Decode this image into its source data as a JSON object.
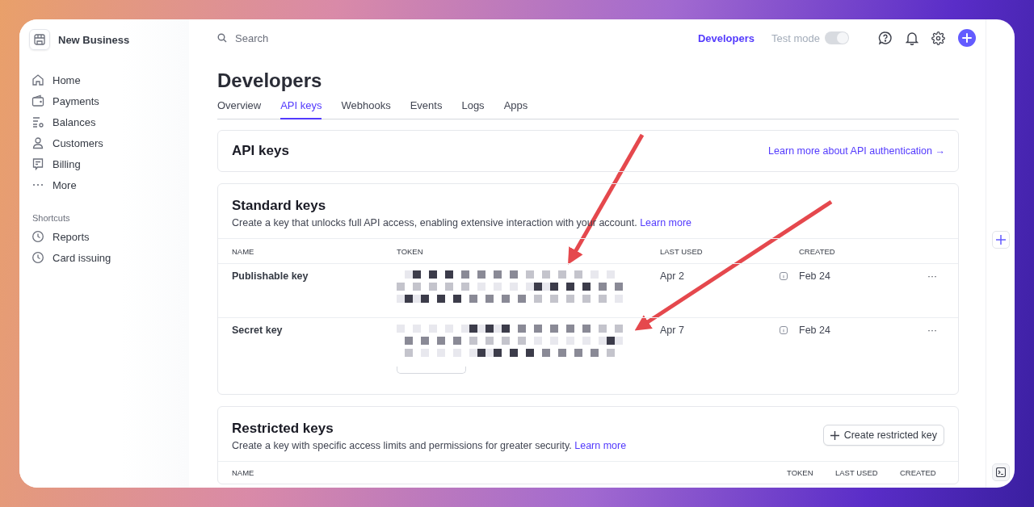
{
  "account": {
    "name": "New Business"
  },
  "search": {
    "placeholder": "Search"
  },
  "topbar": {
    "developers_link": "Developers",
    "test_mode": {
      "label": "Test mode",
      "on": true,
      "disabled": true
    }
  },
  "sidebar": {
    "items": [
      {
        "label": "Home"
      },
      {
        "label": "Payments"
      },
      {
        "label": "Balances"
      },
      {
        "label": "Customers"
      },
      {
        "label": "Billing"
      },
      {
        "label": "More"
      }
    ],
    "shortcuts_title": "Shortcuts",
    "shortcuts": [
      {
        "label": "Reports"
      },
      {
        "label": "Card issuing"
      }
    ]
  },
  "page": {
    "title": "Developers",
    "tabs": [
      {
        "label": "Overview",
        "selected": false
      },
      {
        "label": "API keys",
        "selected": true
      },
      {
        "label": "Webhooks",
        "selected": false
      },
      {
        "label": "Events",
        "selected": false
      },
      {
        "label": "Logs",
        "selected": false
      },
      {
        "label": "Apps",
        "selected": false
      }
    ]
  },
  "api_keys_card": {
    "title": "API keys",
    "link": "Learn more about API authentication →"
  },
  "standard_keys": {
    "title": "Standard keys",
    "description": "Create a key that unlocks full API access, enabling extensive interaction with your account.",
    "link": "Learn more",
    "columns": [
      "NAME",
      "TOKEN",
      "LAST USED",
      "CREATED"
    ],
    "rows": [
      {
        "name": "Publishable key",
        "last_used": "Apr 2",
        "created": "Feb 24",
        "menu": "···"
      },
      {
        "name": "Secret key",
        "last_used": "Apr 7",
        "created": "Feb 24",
        "menu": "···"
      }
    ]
  },
  "restricted_keys": {
    "title": "Restricted keys",
    "description": "Create a key with specific access limits and permissions for greater security.",
    "link": "Learn more",
    "button": "Create restricted key",
    "columns": [
      "NAME",
      "TOKEN",
      "LAST USED",
      "CREATED"
    ]
  }
}
